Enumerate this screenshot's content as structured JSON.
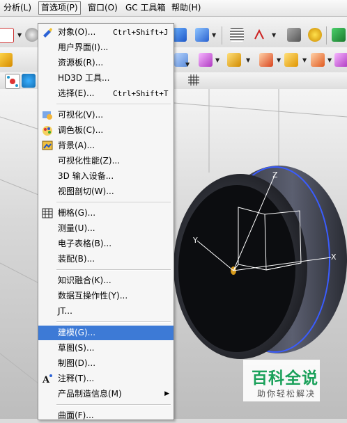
{
  "menubar": {
    "items": [
      {
        "label": "分析(L)"
      },
      {
        "label": "首选项(P)"
      },
      {
        "label": "窗口(O)"
      },
      {
        "label": "GC 工具箱"
      },
      {
        "label": "帮助(H)"
      }
    ]
  },
  "preferences_menu": {
    "items": [
      {
        "label": "对象(O)...",
        "shortcut": "Ctrl+Shift+J",
        "icon": "object-icon"
      },
      {
        "label": "用户界面(I)...",
        "shortcut": ""
      },
      {
        "label": "资源板(R)...",
        "shortcut": ""
      },
      {
        "label": "HD3D 工具...",
        "shortcut": ""
      },
      {
        "label": "选择(E)...",
        "shortcut": "Ctrl+Shift+T"
      },
      {
        "label": "可视化(V)...",
        "icon": "visualization-icon"
      },
      {
        "label": "调色板(C)...",
        "icon": "palette-icon"
      },
      {
        "label": "背景(A)...",
        "icon": "background-icon"
      },
      {
        "label": "可视化性能(Z)..."
      },
      {
        "label": "3D 输入设备..."
      },
      {
        "label": "视图剖切(W)..."
      },
      {
        "label": "栅格(G)...",
        "icon": "grid-icon"
      },
      {
        "label": "测量(U)..."
      },
      {
        "label": "电子表格(B)..."
      },
      {
        "label": "装配(B)..."
      },
      {
        "label": "知识融合(K)..."
      },
      {
        "label": "数据互操作性(Y)..."
      },
      {
        "label": "JT..."
      },
      {
        "label": "建模(G)...",
        "highlighted": true
      },
      {
        "label": "草图(S)..."
      },
      {
        "label": "制图(D)..."
      },
      {
        "label": "注释(T)...",
        "icon": "annotation-icon"
      },
      {
        "label": "产品制造信息(M)",
        "submenu": true
      },
      {
        "label": "曲面(F)..."
      }
    ]
  },
  "viewport": {
    "axis_labels": {
      "x": "X",
      "y": "Y",
      "z": "Z"
    }
  },
  "watermark": {
    "title": "百科全说",
    "subtitle": "助你轻松解决"
  },
  "colors": {
    "highlight": "#3d7ad6",
    "watermark_green": "#1aa15a",
    "wheel_edge": "#3a5cff"
  }
}
